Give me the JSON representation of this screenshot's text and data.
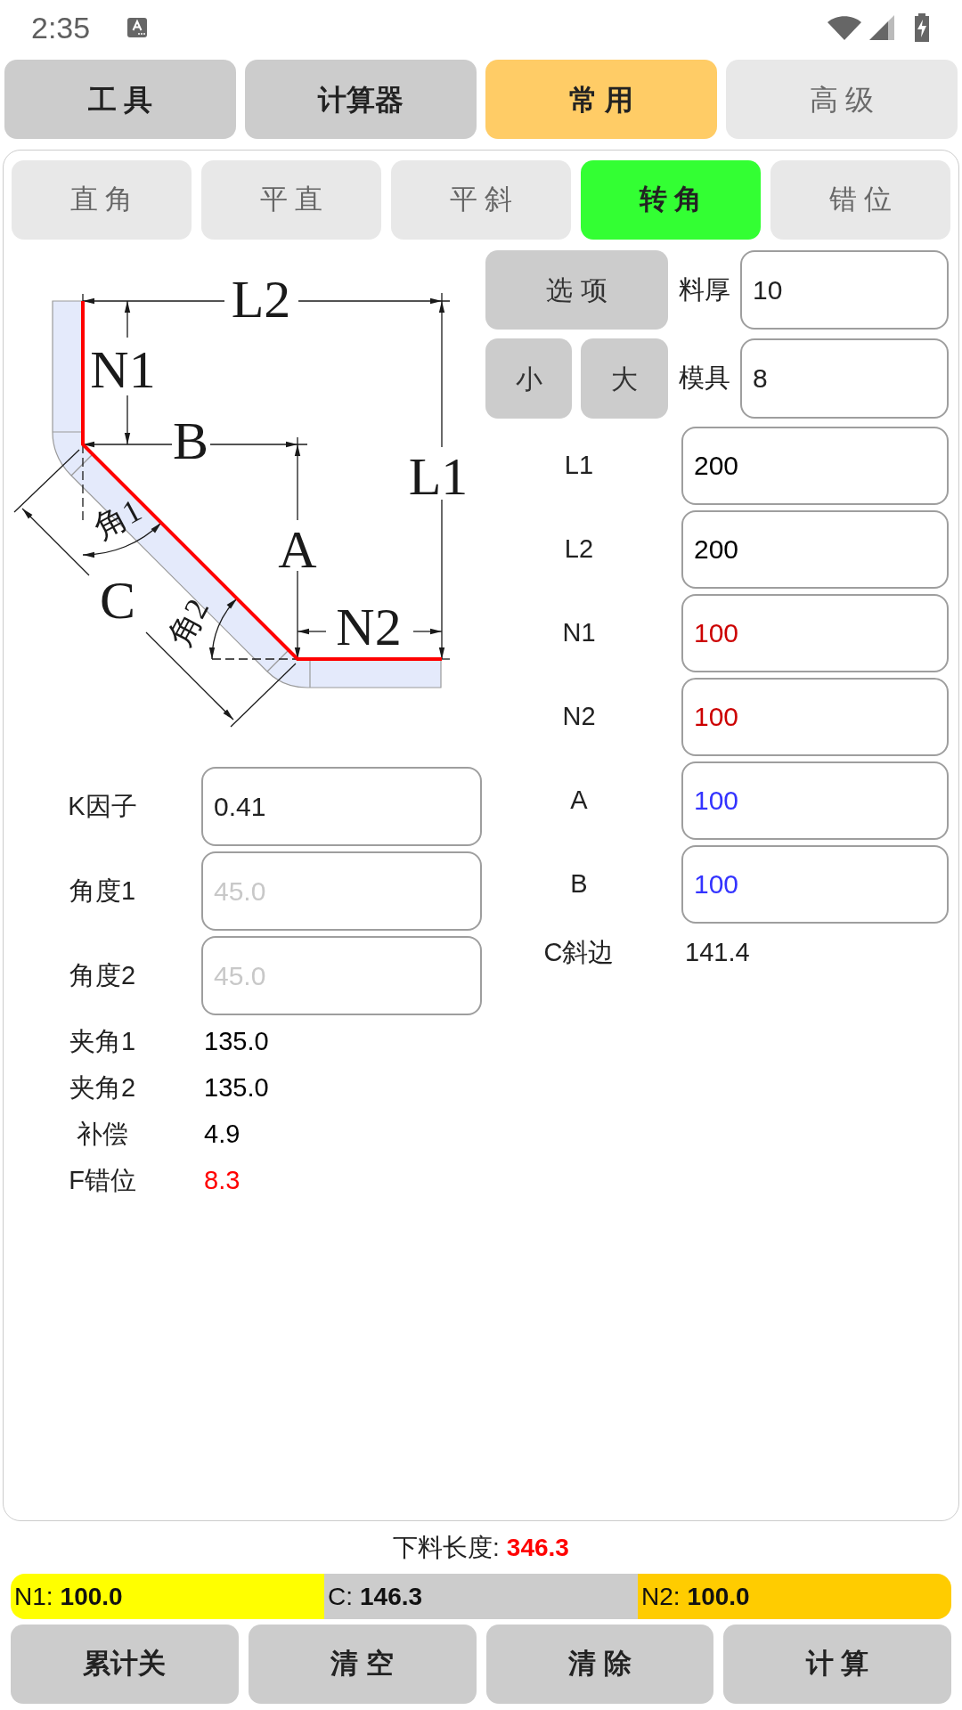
{
  "status_bar": {
    "time": "2:35"
  },
  "top_tabs": [
    {
      "label": "工 具",
      "selected": false,
      "disabled": false
    },
    {
      "label": "计算器",
      "selected": false,
      "disabled": false
    },
    {
      "label": "常 用",
      "selected": true,
      "disabled": false
    },
    {
      "label": "高 级",
      "selected": false,
      "disabled": true
    }
  ],
  "sub_tabs": [
    {
      "label": "直 角",
      "selected": false
    },
    {
      "label": "平 直",
      "selected": false
    },
    {
      "label": "平 斜",
      "selected": false
    },
    {
      "label": "转 角",
      "selected": true
    },
    {
      "label": "错 位",
      "selected": false
    }
  ],
  "diagram": {
    "labels": [
      "L2",
      "N1",
      "B",
      "L1",
      "A",
      "C",
      "N2",
      "角1",
      "角2"
    ]
  },
  "options_button": "选 项",
  "size_buttons": [
    "小",
    "大"
  ],
  "material_fields": [
    {
      "label": "料厚",
      "value": "10"
    },
    {
      "label": "模具",
      "value": "8"
    }
  ],
  "dimension_fields": [
    {
      "label": "L1",
      "value": "200",
      "color": "#000000"
    },
    {
      "label": "L2",
      "value": "200",
      "color": "#000000"
    },
    {
      "label": "N1",
      "value": "100",
      "color": "#cc0000"
    },
    {
      "label": "N2",
      "value": "100",
      "color": "#cc0000"
    },
    {
      "label": "A",
      "value": "100",
      "color": "#3333ff"
    },
    {
      "label": "B",
      "value": "100",
      "color": "#3333ff"
    }
  ],
  "hypotenuse": {
    "label": "C斜边",
    "value": "141.4"
  },
  "angle_fields": [
    {
      "label": "K因子",
      "value": "0.41"
    },
    {
      "label": "角度1",
      "placeholder": "45.0"
    },
    {
      "label": "角度2",
      "placeholder": "45.0"
    }
  ],
  "results": [
    {
      "label": "夹角1",
      "value": "135.0",
      "color": "#000000"
    },
    {
      "label": "夹角2",
      "value": "135.0",
      "color": "#000000"
    },
    {
      "label": "补偿",
      "value": "4.9",
      "color": "#000000"
    },
    {
      "label": "F错位",
      "value": "8.3",
      "color": "#ff0000"
    }
  ],
  "cut_length": {
    "label": "下料长度:",
    "value": "346.3"
  },
  "segments": [
    {
      "label": "N1:",
      "value": "100.0",
      "color": "#ffff00"
    },
    {
      "label": "C:",
      "value": "146.3",
      "color": "#cccccc"
    },
    {
      "label": "N2:",
      "value": "100.0",
      "color": "#ffcc00"
    }
  ],
  "action_buttons": [
    "累计关",
    "清 空",
    "清 除",
    "计 算"
  ]
}
